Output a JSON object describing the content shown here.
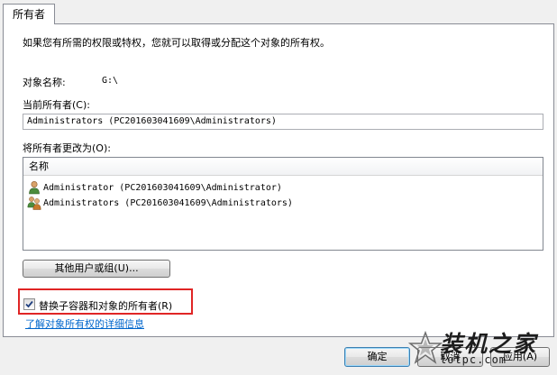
{
  "tab": {
    "label": "所有者"
  },
  "intro_text": "如果您有所需的权限或特权，您就可以取得或分配这个对象的所有权。",
  "object_name": {
    "label": "对象名称:",
    "value": "G:\\"
  },
  "current_owner": {
    "label": "当前所有者(C):",
    "value": "Administrators (PC201603041609\\Administrators)"
  },
  "change_owner": {
    "label": "将所有者更改为(O):",
    "column_header": "名称",
    "items": [
      {
        "label": "Administrator (PC201603041609\\Administrator)",
        "icon": "user-icon"
      },
      {
        "label": "Administrators (PC201603041609\\Administrators)",
        "icon": "user-group-icon"
      }
    ]
  },
  "other_users_button": "其他用户或组(U)...",
  "replace_owner_checkbox": {
    "label": "替换子容器和对象的所有者(R)",
    "checked": true
  },
  "learn_more_link": "了解对象所有权的详细信息",
  "buttons": {
    "ok": "确定",
    "cancel": "取消",
    "apply": "应用(A)"
  },
  "watermark": {
    "title": "装机之家",
    "url": "lotpc.com"
  },
  "colors": {
    "highlight_box": "#e02525",
    "link": "#0066cc",
    "panel_bg": "#ffffff",
    "window_bg": "#f0f0f0"
  }
}
